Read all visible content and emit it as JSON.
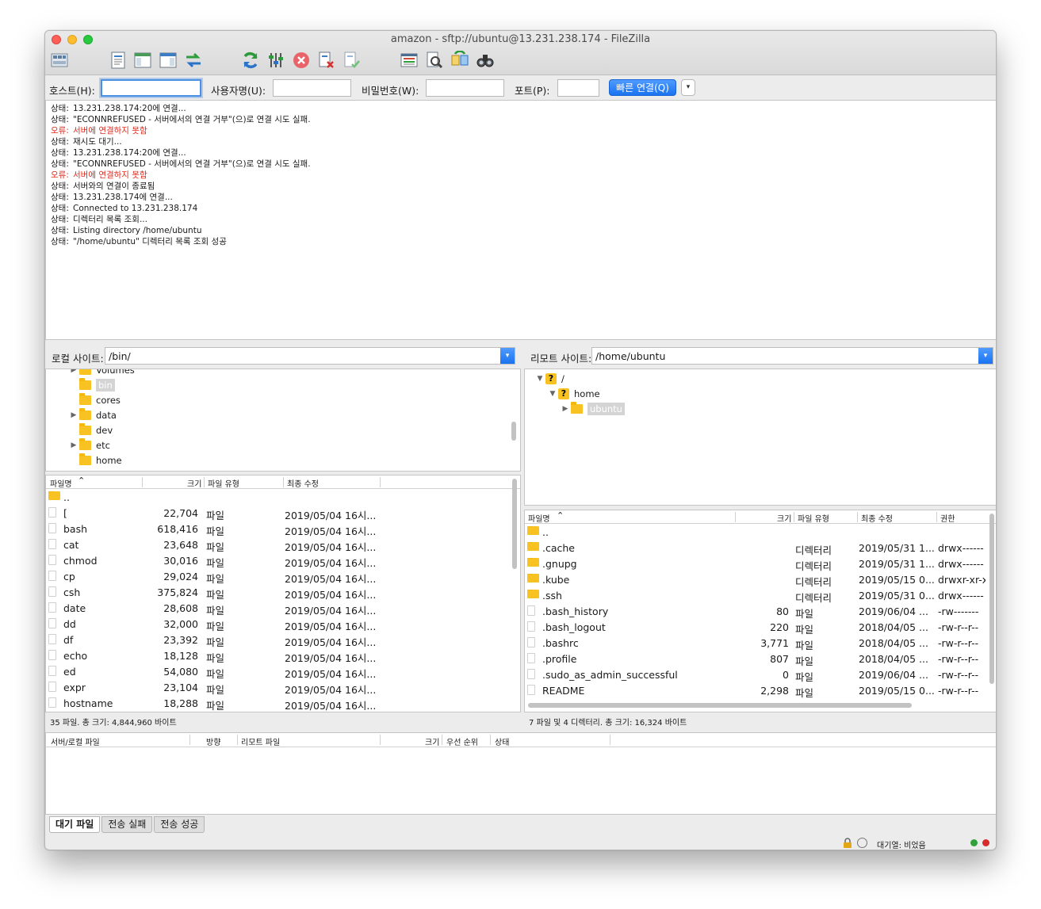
{
  "window": {
    "title": "amazon - sftp://ubuntu@13.231.238.174 - FileZilla"
  },
  "toolbar": {
    "icons": [
      "site-manager-icon",
      "toggle-log-icon",
      "toggle-local-tree-icon",
      "toggle-remote-tree-icon",
      "transfer-queue-icon",
      "refresh-icon",
      "process-queue-icon",
      "cancel-icon",
      "disconnect-icon",
      "reconnect-icon",
      "directory-compare-icon",
      "filter-icon",
      "sync-browse-icon",
      "search-icon"
    ]
  },
  "quickconnect": {
    "host_label": "호스트(H):",
    "user_label": "사용자명(U):",
    "pass_label": "비밀번호(W):",
    "port_label": "포트(P):",
    "host_value": "",
    "user_value": "",
    "pass_value": "",
    "port_value": "",
    "connect_label": "빠른 연결(Q)",
    "dropdown_glyph": "▾"
  },
  "log": [
    {
      "label": "상태:",
      "text": "13.231.238.174:20에 연결...",
      "error": false
    },
    {
      "label": "상태:",
      "text": "\"ECONNREFUSED - 서버에서의 연결 거부\"(으)로 연결 시도 실패.",
      "error": false
    },
    {
      "label": "오류:",
      "text": "서버에 연결하지 못함",
      "error": true
    },
    {
      "label": "상태:",
      "text": "재시도 대기...",
      "error": false
    },
    {
      "label": "상태:",
      "text": "13.231.238.174:20에 연결...",
      "error": false
    },
    {
      "label": "상태:",
      "text": "\"ECONNREFUSED - 서버에서의 연결 거부\"(으)로 연결 시도 실패.",
      "error": false
    },
    {
      "label": "오류:",
      "text": "서버에 연결하지 못함",
      "error": true
    },
    {
      "label": "상태:",
      "text": "서버와의 연결이 종료됨",
      "error": false
    },
    {
      "label": "상태:",
      "text": "13.231.238.174에 연결...",
      "error": false
    },
    {
      "label": "상태:",
      "text": "Connected to 13.231.238.174",
      "error": false
    },
    {
      "label": "상태:",
      "text": "디렉터리 목록 조회...",
      "error": false
    },
    {
      "label": "상태:",
      "text": "Listing directory /home/ubuntu",
      "error": false
    },
    {
      "label": "상태:",
      "text": "\"/home/ubuntu\" 디렉터리 목록 조회 성공",
      "error": false
    }
  ],
  "local": {
    "site_label": "로컬 사이트:",
    "path": "/bin/",
    "tree": [
      {
        "name": "Volumes",
        "arrow": "▶",
        "selected": false
      },
      {
        "name": "bin",
        "arrow": "",
        "selected": true
      },
      {
        "name": "cores",
        "arrow": "",
        "selected": false
      },
      {
        "name": "data",
        "arrow": "▶",
        "selected": false
      },
      {
        "name": "dev",
        "arrow": "",
        "selected": false
      },
      {
        "name": "etc",
        "arrow": "▶",
        "selected": false
      },
      {
        "name": "home",
        "arrow": "",
        "selected": false
      }
    ],
    "columns": {
      "name": "파일명",
      "size": "크기",
      "type": "파일 유형",
      "modified": "최종 수정"
    },
    "files": [
      {
        "name": "..",
        "size": "",
        "type": "",
        "modified": "",
        "folder": true
      },
      {
        "name": "[",
        "size": "22,704",
        "type": "파일",
        "modified": "2019/05/04 16시...",
        "folder": false
      },
      {
        "name": "bash",
        "size": "618,416",
        "type": "파일",
        "modified": "2019/05/04 16시...",
        "folder": false
      },
      {
        "name": "cat",
        "size": "23,648",
        "type": "파일",
        "modified": "2019/05/04 16시...",
        "folder": false
      },
      {
        "name": "chmod",
        "size": "30,016",
        "type": "파일",
        "modified": "2019/05/04 16시...",
        "folder": false
      },
      {
        "name": "cp",
        "size": "29,024",
        "type": "파일",
        "modified": "2019/05/04 16시...",
        "folder": false
      },
      {
        "name": "csh",
        "size": "375,824",
        "type": "파일",
        "modified": "2019/05/04 16시...",
        "folder": false
      },
      {
        "name": "date",
        "size": "28,608",
        "type": "파일",
        "modified": "2019/05/04 16시...",
        "folder": false
      },
      {
        "name": "dd",
        "size": "32,000",
        "type": "파일",
        "modified": "2019/05/04 16시...",
        "folder": false
      },
      {
        "name": "df",
        "size": "23,392",
        "type": "파일",
        "modified": "2019/05/04 16시...",
        "folder": false
      },
      {
        "name": "echo",
        "size": "18,128",
        "type": "파일",
        "modified": "2019/05/04 16시...",
        "folder": false
      },
      {
        "name": "ed",
        "size": "54,080",
        "type": "파일",
        "modified": "2019/05/04 16시...",
        "folder": false
      },
      {
        "name": "expr",
        "size": "23,104",
        "type": "파일",
        "modified": "2019/05/04 16시...",
        "folder": false
      },
      {
        "name": "hostname",
        "size": "18,288",
        "type": "파일",
        "modified": "2019/05/04 16시...",
        "folder": false
      }
    ],
    "status": "35 파일. 총 크기: 4,844,960 바이트"
  },
  "remote": {
    "site_label": "리모트 사이트:",
    "path": "/home/ubuntu",
    "tree": [
      {
        "name": "/",
        "arrow": "▼",
        "selected": false,
        "unknown": true
      },
      {
        "name": "home",
        "arrow": "▼",
        "selected": false,
        "unknown": true
      },
      {
        "name": "ubuntu",
        "arrow": "▶",
        "selected": true,
        "unknown": false
      }
    ],
    "columns": {
      "name": "파일명",
      "size": "크기",
      "type": "파일 유형",
      "modified": "최종 수정",
      "perms": "권한"
    },
    "files": [
      {
        "name": "..",
        "size": "",
        "type": "",
        "modified": "",
        "perms": "",
        "folder": true
      },
      {
        "name": ".cache",
        "size": "",
        "type": "디렉터리",
        "modified": "2019/05/31 1...",
        "perms": "drwx------",
        "folder": true
      },
      {
        "name": ".gnupg",
        "size": "",
        "type": "디렉터리",
        "modified": "2019/05/31 1...",
        "perms": "drwx------",
        "folder": true
      },
      {
        "name": ".kube",
        "size": "",
        "type": "디렉터리",
        "modified": "2019/05/15 0...",
        "perms": "drwxr-xr-x",
        "folder": true
      },
      {
        "name": ".ssh",
        "size": "",
        "type": "디렉터리",
        "modified": "2019/05/31 0...",
        "perms": "drwx------",
        "folder": true
      },
      {
        "name": ".bash_history",
        "size": "80",
        "type": "파일",
        "modified": "2019/06/04 ...",
        "perms": "-rw-------",
        "folder": false
      },
      {
        "name": ".bash_logout",
        "size": "220",
        "type": "파일",
        "modified": "2018/04/05 ...",
        "perms": "-rw-r--r--",
        "folder": false
      },
      {
        "name": ".bashrc",
        "size": "3,771",
        "type": "파일",
        "modified": "2018/04/05 ...",
        "perms": "-rw-r--r--",
        "folder": false
      },
      {
        "name": ".profile",
        "size": "807",
        "type": "파일",
        "modified": "2018/04/05 ...",
        "perms": "-rw-r--r--",
        "folder": false
      },
      {
        "name": ".sudo_as_admin_successful",
        "size": "0",
        "type": "파일",
        "modified": "2019/06/04 ...",
        "perms": "-rw-r--r--",
        "folder": false
      },
      {
        "name": "README",
        "size": "2,298",
        "type": "파일",
        "modified": "2019/05/15 0...",
        "perms": "-rw-r--r--",
        "folder": false
      }
    ],
    "status": "7 파일 및 4 디렉터리. 총 크기: 16,324 바이트"
  },
  "queue": {
    "columns": {
      "server_file": "서버/로컬 파일",
      "direction": "방향",
      "remote_file": "리모트 파일",
      "size": "크기",
      "priority": "우선 순위",
      "status": "상태"
    },
    "tabs": [
      "대기 파일",
      "전송 실패",
      "전송 성공"
    ],
    "active_tab": 0,
    "status_text": "대기열: 비었음"
  },
  "colors": {
    "accent": "#1a73f0",
    "error": "#e0281c",
    "folder": "#f8c322",
    "led_green": "#2fa33a",
    "led_red": "#d62b2b"
  }
}
